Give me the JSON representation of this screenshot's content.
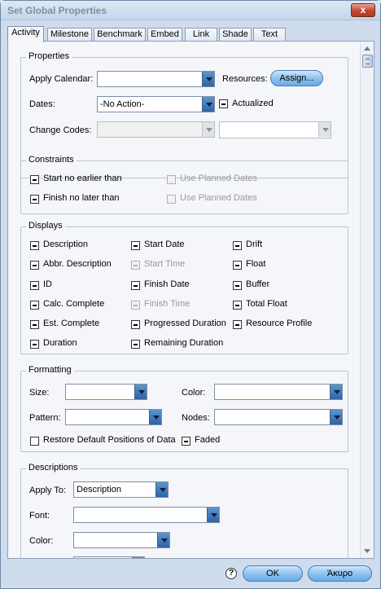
{
  "window": {
    "title": "Set Global Properties",
    "close_glyph": "x"
  },
  "tabs": [
    {
      "label": "Activity"
    },
    {
      "label": "Milestone"
    },
    {
      "label": "Benchmark"
    },
    {
      "label": "Embed"
    },
    {
      "label": "Link"
    },
    {
      "label": "Shade"
    },
    {
      "label": "Text"
    }
  ],
  "properties": {
    "title": "Properties",
    "apply_calendar_label": "Apply Calendar:",
    "apply_calendar_value": "",
    "resources_label": "Resources:",
    "assign_button": "Assign...",
    "dates_label": "Dates:",
    "dates_value": "-No Action-",
    "actualized_label": "Actualized",
    "change_codes_label": "Change Codes:"
  },
  "constraints": {
    "title": "Constraints",
    "start_no_earlier": "Start no earlier than",
    "finish_no_later": "Finish no later than",
    "use_planned_dates_1": "Use Planned Dates",
    "use_planned_dates_2": "Use Planned Dates"
  },
  "displays": {
    "title": "Displays",
    "col1": [
      "Description",
      "Abbr. Description",
      "ID",
      "Calc. Complete",
      "Est. Complete",
      "Duration"
    ],
    "col2": [
      "Start Date",
      "Start Time",
      "Finish Date",
      "Finish Time",
      "Progressed Duration",
      "Remaining Duration"
    ],
    "col3": [
      "Drift",
      "Float",
      "Buffer",
      "Total Float",
      "Resource Profile"
    ]
  },
  "formatting": {
    "title": "Formatting",
    "size_label": "Size:",
    "color_label": "Color:",
    "pattern_label": "Pattern:",
    "nodes_label": "Nodes:",
    "restore_label": "Restore Default Positions of Data",
    "faded_label": "Faded"
  },
  "descriptions": {
    "title": "Descriptions",
    "apply_to_label": "Apply To:",
    "apply_to_value": "Description",
    "font_label": "Font:",
    "color_label": "Color:"
  },
  "footer": {
    "help_glyph": "?",
    "ok": "OK",
    "cancel": "Άκυρο"
  }
}
